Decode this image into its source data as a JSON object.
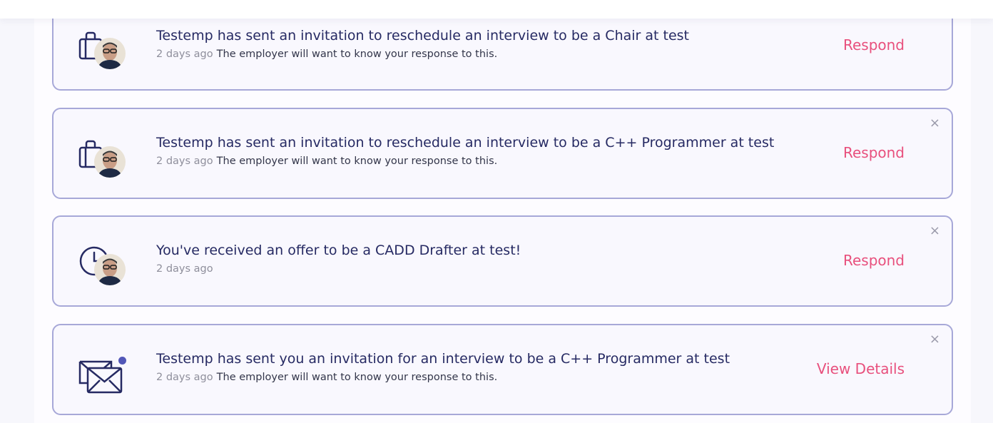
{
  "notifications": [
    {
      "title": "Testemp has sent an invitation to reschedule an interview to be a Chair at test",
      "time_ago": "2 days ago",
      "description": "The employer will want to know your response to this.",
      "action_label": "Respond",
      "icon": "briefcase-icon",
      "has_avatar": true,
      "dismiss_icon": "×"
    },
    {
      "title": "Testemp has sent an invitation to reschedule an interview to be a C++ Programmer at test",
      "time_ago": "2 days ago",
      "description": "The employer will want to know your response to this.",
      "action_label": "Respond",
      "icon": "briefcase-icon",
      "has_avatar": true,
      "dismiss_icon": "×"
    },
    {
      "title": "You've received an offer to be a CADD Drafter at test!",
      "time_ago": "2 days ago",
      "description": "",
      "action_label": "Respond",
      "icon": "clock-icon",
      "has_avatar": true,
      "dismiss_icon": "×"
    },
    {
      "title": "Testemp has sent you an invitation for an interview to be a C++ Programmer at test",
      "time_ago": "2 days ago",
      "description": "The employer will want to know your response to this.",
      "action_label": "View Details",
      "icon": "envelope-icon",
      "has_avatar": false,
      "unread_dot": true,
      "dismiss_icon": "×"
    }
  ],
  "colors": {
    "card_border": "#a7a8d8",
    "card_background": "#f9f8fe",
    "title_text": "#262a63",
    "action_text": "#e8507d",
    "muted_text": "#8f8f9c",
    "unread_dot": "#5257b8"
  }
}
